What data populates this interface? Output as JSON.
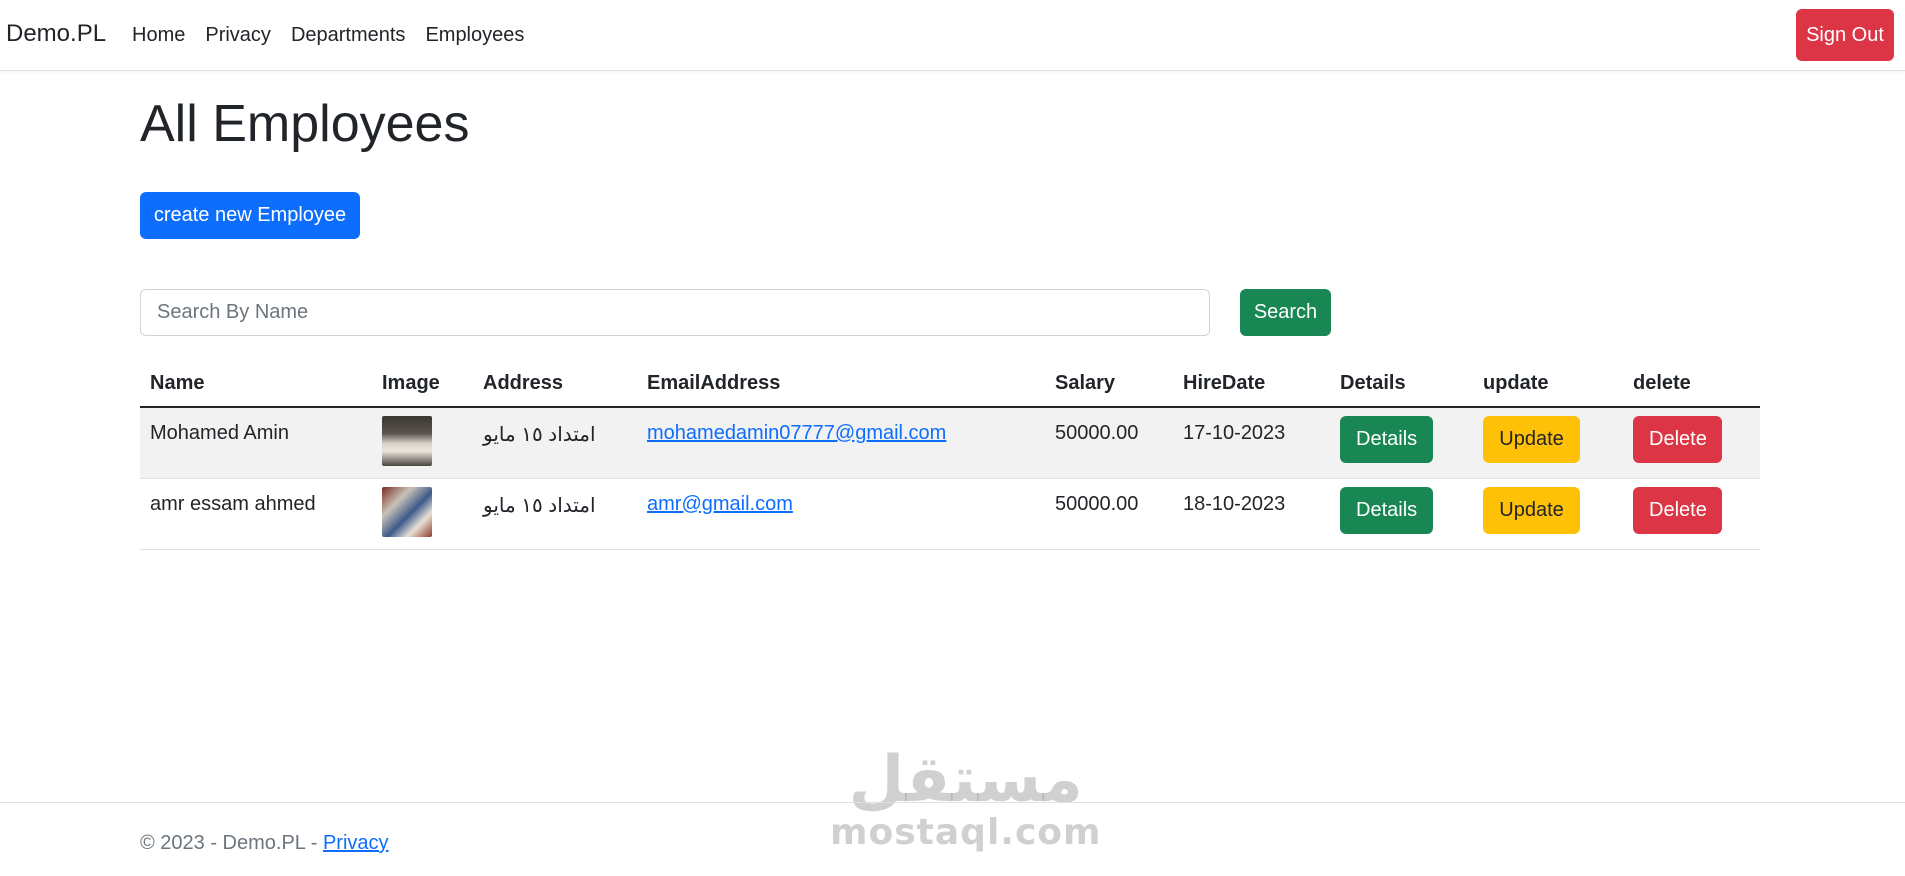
{
  "navbar": {
    "brand": "Demo.PL",
    "links": [
      "Home",
      "Privacy",
      "Departments",
      "Employees"
    ],
    "sign_out": "Sign Out"
  },
  "main": {
    "title": "All Employees",
    "create_button": "create new Employee",
    "search": {
      "placeholder": "Search By Name",
      "value": "",
      "button": "Search"
    },
    "table": {
      "headers": [
        "Name",
        "Image",
        "Address",
        "EmailAddress",
        "Salary",
        "HireDate",
        "Details",
        "update",
        "delete"
      ],
      "rows": [
        {
          "name": "Mohamed Amin",
          "address": "امتداد ١٥ مايو",
          "email": "mohamedamin07777@gmail.com",
          "salary": "50000.00",
          "hire_date": "17-10-2023",
          "details": "Details",
          "update": "Update",
          "delete": "Delete"
        },
        {
          "name": "amr essam ahmed",
          "address": "امتداد ١٥ مايو",
          "email": "amr@gmail.com",
          "salary": "50000.00",
          "hire_date": "18-10-2023",
          "details": "Details",
          "update": "Update",
          "delete": "Delete"
        }
      ]
    }
  },
  "footer": {
    "text": "© 2023 - Demo.PL - ",
    "link": "Privacy"
  },
  "watermark": {
    "arabic": "مستقل",
    "latin": "mostaql.com"
  },
  "colors": {
    "primary": "#0d6efd",
    "success": "#198754",
    "warning": "#ffc107",
    "danger": "#dc3545"
  }
}
